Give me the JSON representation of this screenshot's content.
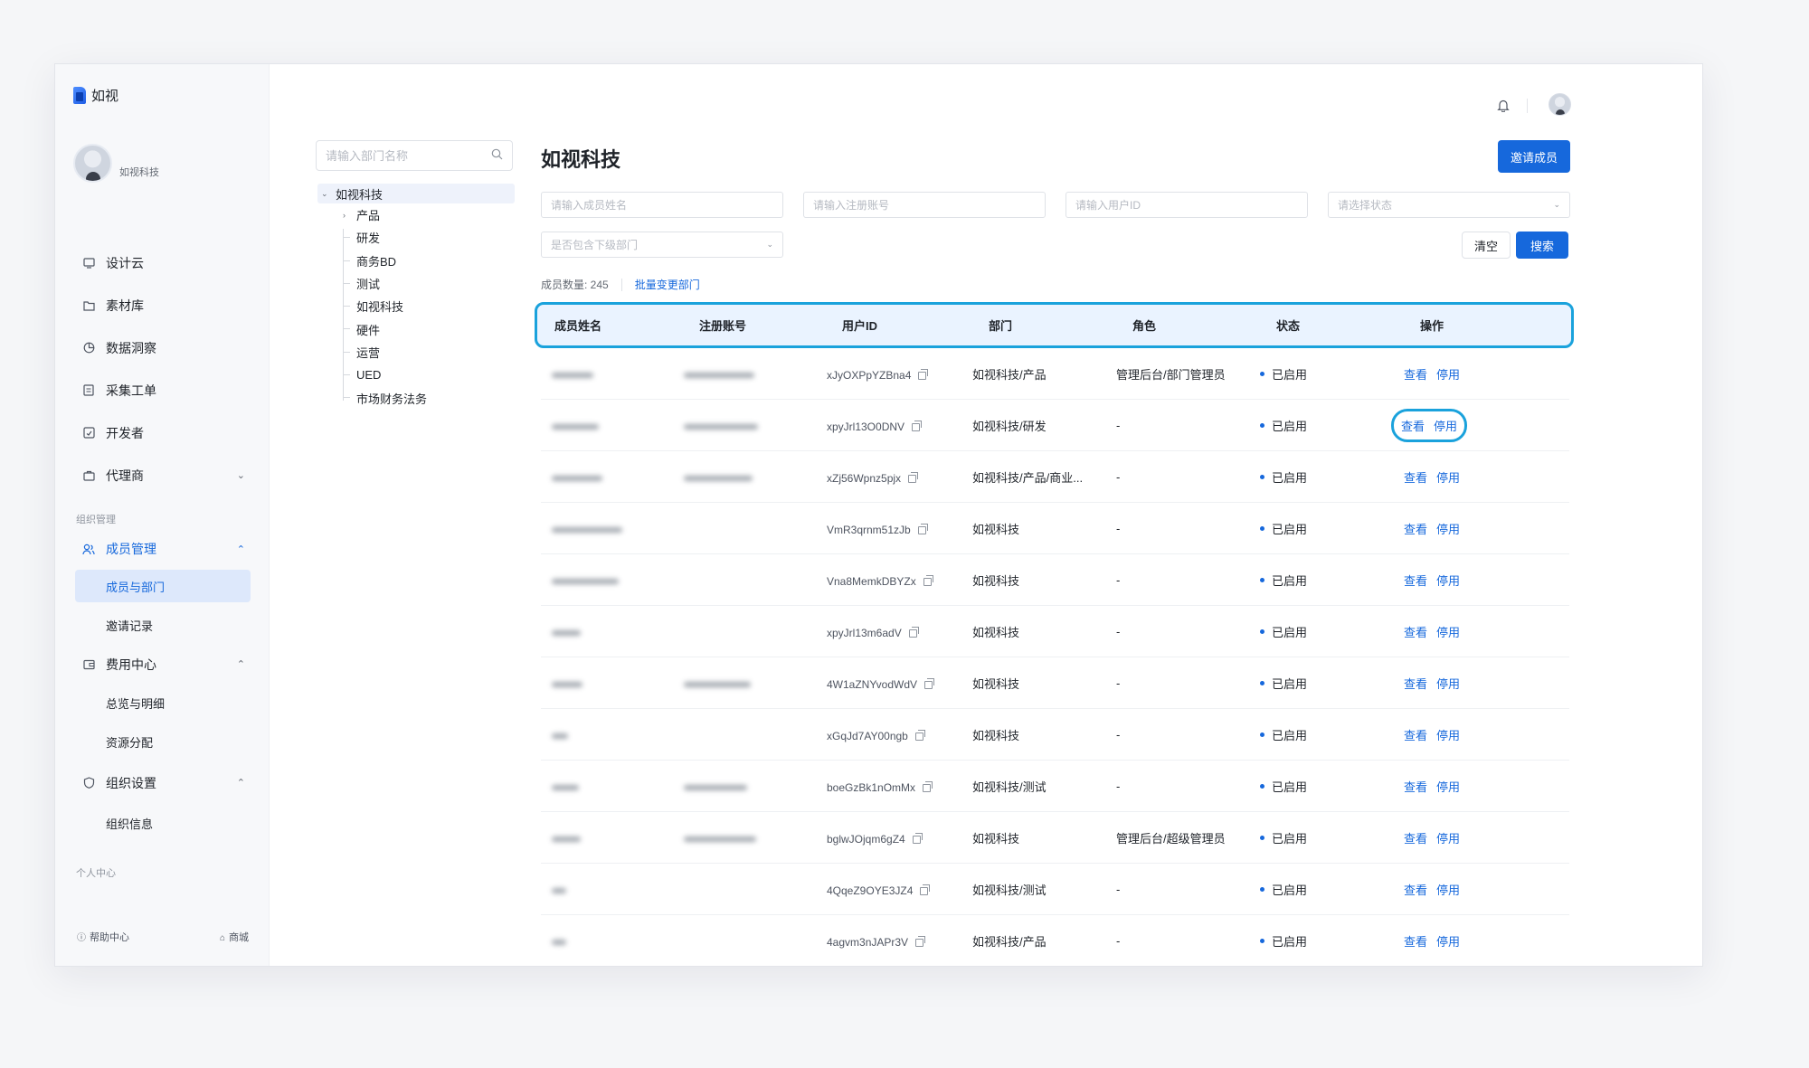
{
  "app": {
    "name": "如视"
  },
  "profile": {
    "org_name": "如视科技"
  },
  "nav": {
    "items": [
      {
        "label": "设计云",
        "icon": "monitor-icon"
      },
      {
        "label": "素材库",
        "icon": "folder-icon"
      },
      {
        "label": "数据洞察",
        "icon": "pie-chart-icon"
      },
      {
        "label": "采集工单",
        "icon": "document-icon"
      },
      {
        "label": "开发者",
        "icon": "code-icon"
      },
      {
        "label": "代理商",
        "icon": "briefcase-icon"
      }
    ],
    "section_org": "组织管理",
    "member_mgmt": "成员管理",
    "member_dept": "成员与部门",
    "invite_records": "邀请记录",
    "billing": "费用中心",
    "overview": "总览与明细",
    "resource_alloc": "资源分配",
    "org_settings": "组织设置",
    "org_info": "组织信息",
    "section_personal": "个人中心",
    "help": "帮助中心",
    "mall": "商城"
  },
  "dept_search_placeholder": "请输入部门名称",
  "dept_tree": {
    "root": "如视科技",
    "children": [
      "产品",
      "研发",
      "商务BD",
      "测试",
      "如视科技",
      "硬件",
      "运营",
      "UED",
      "市场财务法务"
    ]
  },
  "page_title": "如视科技",
  "invite_button": "邀请成员",
  "filters": {
    "name_placeholder": "请输入成员姓名",
    "account_placeholder": "请输入注册账号",
    "userid_placeholder": "请输入用户ID",
    "status_placeholder": "请选择状态",
    "subdept_placeholder": "是否包含下级部门"
  },
  "clear_button": "清空",
  "search_button": "搜索",
  "member_count_label": "成员数量: 245",
  "batch_change_dept": "批量变更部门",
  "table": {
    "headers": [
      "成员姓名",
      "注册账号",
      "用户ID",
      "部门",
      "角色",
      "状态",
      "操作"
    ],
    "view_label": "查看",
    "disable_label": "停用",
    "rows": [
      {
        "uid": "xJyOXPpYZBna4",
        "dept": "如视科技/产品",
        "role": "管理后台/部门管理员",
        "status": "已启用"
      },
      {
        "uid": "xpyJrl13O0DNV",
        "dept": "如视科技/研发",
        "role": "-",
        "status": "已启用"
      },
      {
        "uid": "xZj56Wpnz5pjx",
        "dept": "如视科技/产品/商业...",
        "role": "-",
        "status": "已启用"
      },
      {
        "uid": "VmR3qrnm51zJb",
        "dept": "如视科技",
        "role": "-",
        "status": "已启用"
      },
      {
        "uid": "Vna8MemkDBYZx",
        "dept": "如视科技",
        "role": "-",
        "status": "已启用"
      },
      {
        "uid": "xpyJrl13m6adV",
        "dept": "如视科技",
        "role": "-",
        "status": "已启用"
      },
      {
        "uid": "4W1aZNYvodWdV",
        "dept": "如视科技",
        "role": "-",
        "status": "已启用"
      },
      {
        "uid": "xGqJd7AY00ngb",
        "dept": "如视科技",
        "role": "-",
        "status": "已启用"
      },
      {
        "uid": "boeGzBk1nOmMx",
        "dept": "如视科技/测试",
        "role": "-",
        "status": "已启用"
      },
      {
        "uid": "bglwJOjqm6gZ4",
        "dept": "如视科技",
        "role": "管理后台/超级管理员",
        "status": "已启用"
      },
      {
        "uid": "4QqeZ9OYE3JZ4",
        "dept": "如视科技/测试",
        "role": "-",
        "status": "已启用"
      },
      {
        "uid": "4agvm3nJAPr3V",
        "dept": "如视科技/产品",
        "role": "-",
        "status": "已启用"
      }
    ]
  }
}
